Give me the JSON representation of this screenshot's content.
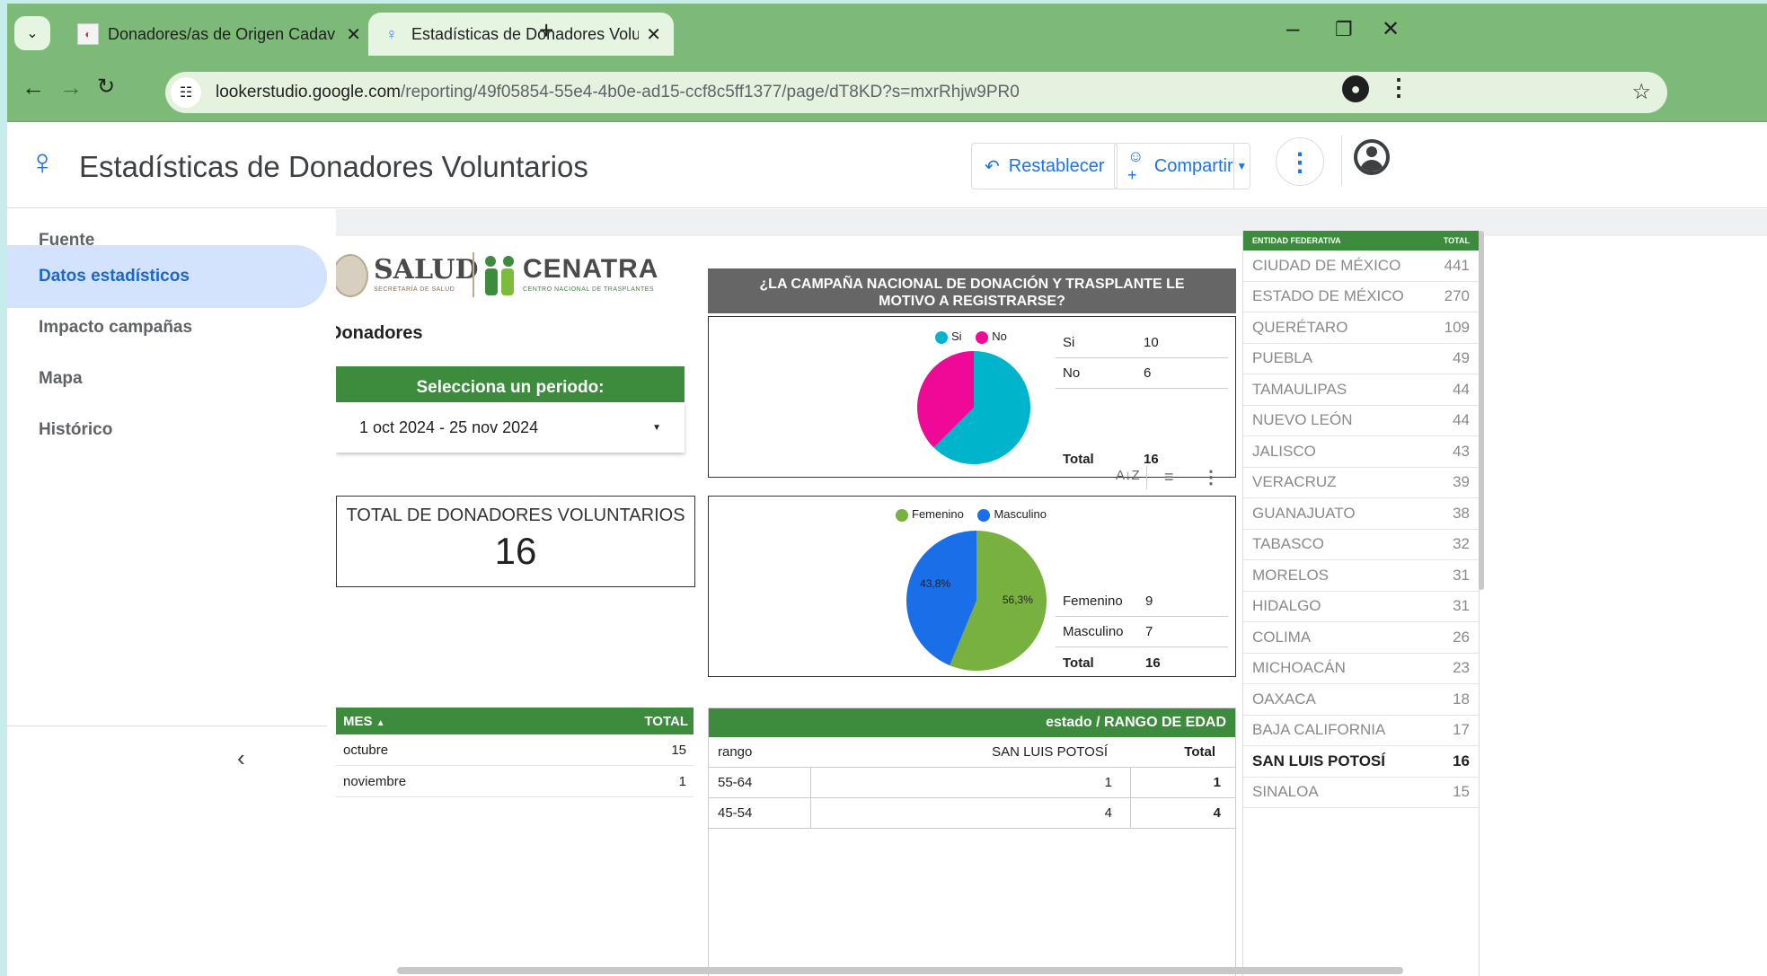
{
  "browser": {
    "tabs": [
      {
        "title": "Donadores/as de Origen Cadav",
        "active": false
      },
      {
        "title": "Estadísticas de Donadores Volu",
        "active": true
      }
    ],
    "url_host": "lookerstudio.google.com",
    "url_path": "/reporting/49f05854-55e4-4b0e-ad15-ccf8c5ff1377/page/dT8KD?s=mxrRhjw9PR0"
  },
  "app": {
    "title": "Estadísticas de Donadores Voluntarios",
    "reset_label": "Restablecer",
    "share_label": "Compartir"
  },
  "sidebar": {
    "items": [
      "Fuente",
      "Datos estadísticos",
      "Impacto campañas",
      "Mapa",
      "Histórico"
    ],
    "selected_index": 1
  },
  "report": {
    "logo_salud": "SALUD",
    "logo_salud_sub": "SECRETARÍA DE SALUD",
    "logo_cenatra": "CENATRA",
    "logo_cenatra_sub": "CENTRO NACIONAL DE TRASPLANTES",
    "donadores_label": "Donadores",
    "period_header": "Selecciona un periodo:",
    "period_value": "1 oct 2024 - 25 nov 2024",
    "total_title": "TOTAL DE DONADORES VOLUNTARIOS",
    "total_value": "16",
    "campaign_title": "¿LA CAMPAÑA NACIONAL DE DONACIÓN Y TRASPLANTE LE MOTIVO A REGISTRARSE?",
    "mes_table": {
      "headers": [
        "MES",
        "TOTAL"
      ],
      "rows": [
        [
          "octubre",
          "15"
        ],
        [
          "noviembre",
          "1"
        ]
      ]
    },
    "edad_table": {
      "title": "estado / RANGO DE EDAD",
      "headers": [
        "rango",
        "SAN LUIS POTOSÍ",
        "Total"
      ],
      "rows": [
        [
          "55-64",
          "1",
          "1"
        ],
        [
          "45-54",
          "4",
          "4"
        ]
      ]
    },
    "entidad_table": {
      "headers": [
        "ENTIDAD FEDERATIVA",
        "TOTAL"
      ],
      "rows": [
        [
          "CIUDAD DE MÉXICO",
          "441"
        ],
        [
          "ESTADO DE MÉXICO",
          "270"
        ],
        [
          "QUERÉTARO",
          "109"
        ],
        [
          "PUEBLA",
          "49"
        ],
        [
          "TAMAULIPAS",
          "44"
        ],
        [
          "NUEVO LEÓN",
          "44"
        ],
        [
          "JALISCO",
          "43"
        ],
        [
          "VERACRUZ",
          "39"
        ],
        [
          "GUANAJUATO",
          "38"
        ],
        [
          "TABASCO",
          "32"
        ],
        [
          "MORELOS",
          "31"
        ],
        [
          "HIDALGO",
          "31"
        ],
        [
          "COLIMA",
          "26"
        ],
        [
          "MICHOACÁN",
          "23"
        ],
        [
          "OAXACA",
          "18"
        ],
        [
          "BAJA CALIFORNIA",
          "17"
        ],
        [
          "SAN LUIS POTOSÍ",
          "16"
        ],
        [
          "SINALOA",
          "15"
        ]
      ],
      "highlight_index": 16
    }
  },
  "chart_data": [
    {
      "type": "pie",
      "categories": [
        "Si",
        "No"
      ],
      "values": [
        10,
        6
      ],
      "colors": [
        "#00b4cc",
        "#ee0a96"
      ],
      "table": {
        "rows": [
          [
            "Si",
            "10"
          ],
          [
            "No",
            "6"
          ]
        ],
        "total_label": "Total",
        "total": "16"
      }
    },
    {
      "type": "pie",
      "categories": [
        "Femenino",
        "Masculino"
      ],
      "values": [
        9,
        7
      ],
      "colors": [
        "#78b13f",
        "#1a6fe8"
      ],
      "data_labels": [
        "56,3%",
        "43,8%"
      ],
      "table": {
        "rows": [
          [
            "Femenino",
            "9"
          ],
          [
            "Masculino",
            "7"
          ]
        ],
        "total_label": "Total",
        "total": "16"
      }
    }
  ],
  "icons": [
    "chevron-down-icon",
    "close-icon",
    "plus-icon",
    "minimize-icon",
    "restore-icon",
    "back-icon",
    "forward-icon",
    "reload-icon",
    "site-info-icon",
    "star-icon",
    "profile-icon",
    "more-icon",
    "looker-logo-icon",
    "undo-icon",
    "add-person-icon",
    "account-icon",
    "collapse-icon",
    "sort-az-icon",
    "filter-icon"
  ]
}
